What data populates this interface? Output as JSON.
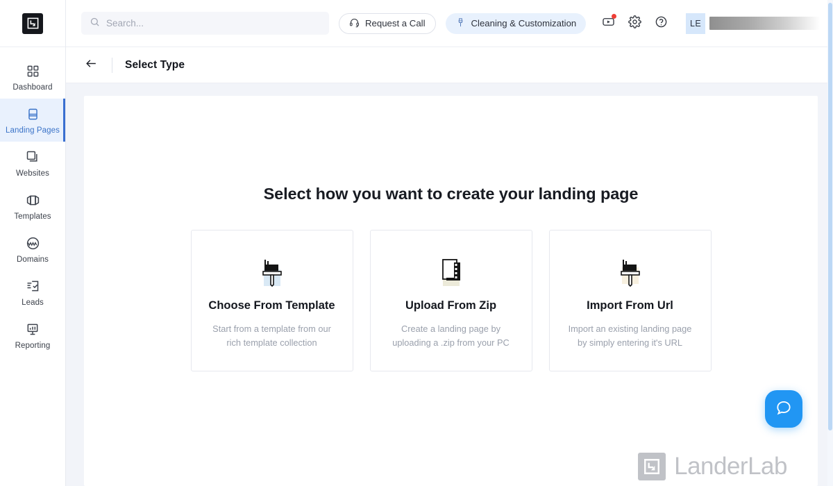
{
  "brand": {
    "mark_icon": "landerlab-logo-icon"
  },
  "sidebar": {
    "items": [
      {
        "label": "Dashboard",
        "icon": "grid-icon",
        "active": false
      },
      {
        "label": "Landing Pages",
        "icon": "page-icon",
        "active": true
      },
      {
        "label": "Websites",
        "icon": "layers-icon",
        "active": false
      },
      {
        "label": "Templates",
        "icon": "templates-icon",
        "active": false
      },
      {
        "label": "Domains",
        "icon": "globe-www-icon",
        "active": false
      },
      {
        "label": "Leads",
        "icon": "checklist-icon",
        "active": false
      },
      {
        "label": "Reporting",
        "icon": "chart-board-icon",
        "active": false
      }
    ]
  },
  "topbar": {
    "search": {
      "placeholder": "Search...",
      "value": "",
      "icon": "search-icon"
    },
    "request_call": {
      "label": "Request a Call",
      "icon": "headset-icon"
    },
    "cleaning": {
      "label": "Cleaning & Customization",
      "icon": "brush-icon"
    },
    "video_icon": "video-tutorial-icon",
    "settings_icon": "gear-icon",
    "help_icon": "help-circle-icon",
    "user": {
      "initials": "LE",
      "name_redacted": true
    }
  },
  "page_header": {
    "back_icon": "arrow-left-icon",
    "title": "Select Type"
  },
  "main": {
    "headline": "Select how you want to create your landing page",
    "cards": [
      {
        "title": "Choose From Template",
        "desc": "Start from a template from our rich template collection",
        "icon": "paintbrush-icon"
      },
      {
        "title": "Upload From Zip",
        "desc": "Create a landing page by uploading a .zip from your PC",
        "icon": "zip-file-icon"
      },
      {
        "title": "Import From Url",
        "desc": "Import an existing landing page by simply entering it's URL",
        "icon": "paintbrush-icon"
      }
    ]
  },
  "watermark": {
    "text": "LanderLab",
    "icon": "landerlab-logo-icon"
  },
  "chat": {
    "icon": "chat-bubble-icon"
  },
  "colors": {
    "accent_blue": "#3a6fd0",
    "active_bg": "#e9f1fd",
    "content_bg": "#f2f4f9",
    "chat_blue": "#2196f3",
    "badge_red": "#ef3e36",
    "muted_text": "#9aa0ac"
  }
}
